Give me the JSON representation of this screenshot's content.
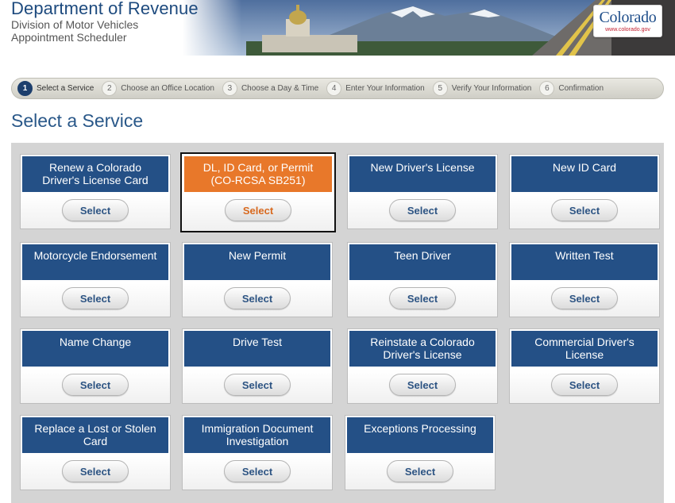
{
  "header": {
    "title": "Department of Revenue",
    "subtitle1": "Division of Motor Vehicles",
    "subtitle2": "Appointment Scheduler",
    "logo_word": "Colorado",
    "logo_url": "www.colorado.gov"
  },
  "steps": [
    {
      "num": "1",
      "label": "Select a Service",
      "active": true
    },
    {
      "num": "2",
      "label": "Choose an Office Location",
      "active": false
    },
    {
      "num": "3",
      "label": "Choose a Day & Time",
      "active": false
    },
    {
      "num": "4",
      "label": "Enter Your Information",
      "active": false
    },
    {
      "num": "5",
      "label": "Verify Your Information",
      "active": false
    },
    {
      "num": "6",
      "label": "Confirmation",
      "active": false
    }
  ],
  "page_title": "Select a Service",
  "select_label": "Select",
  "colors": {
    "brand_blue": "#245086",
    "highlight_orange": "#e8782a",
    "title_blue": "#2a5889"
  },
  "services": [
    {
      "line1": "Renew a Colorado",
      "line2": "Driver's License Card",
      "highlight": false
    },
    {
      "line1": "DL, ID Card, or Permit",
      "line2": "(CO-RCSA SB251)",
      "highlight": true
    },
    {
      "line1": "New Driver's License",
      "line2": "",
      "highlight": false
    },
    {
      "line1": "New ID Card",
      "line2": "",
      "highlight": false
    },
    {
      "line1": "Motorcycle Endorsement",
      "line2": "",
      "highlight": false
    },
    {
      "line1": "New Permit",
      "line2": "",
      "highlight": false
    },
    {
      "line1": "Teen Driver",
      "line2": "",
      "highlight": false
    },
    {
      "line1": "Written Test",
      "line2": "",
      "highlight": false
    },
    {
      "line1": "Name Change",
      "line2": "",
      "highlight": false
    },
    {
      "line1": "Drive Test",
      "line2": "",
      "highlight": false
    },
    {
      "line1": "Reinstate a Colorado",
      "line2": "Driver's License",
      "highlight": false
    },
    {
      "line1": "Commercial Driver's",
      "line2": "License",
      "highlight": false
    },
    {
      "line1": "Replace a Lost or Stolen",
      "line2": "Card",
      "highlight": false
    },
    {
      "line1": "Immigration Document",
      "line2": "Investigation",
      "highlight": false
    },
    {
      "line1": "Exceptions Processing",
      "line2": "",
      "highlight": false
    }
  ]
}
